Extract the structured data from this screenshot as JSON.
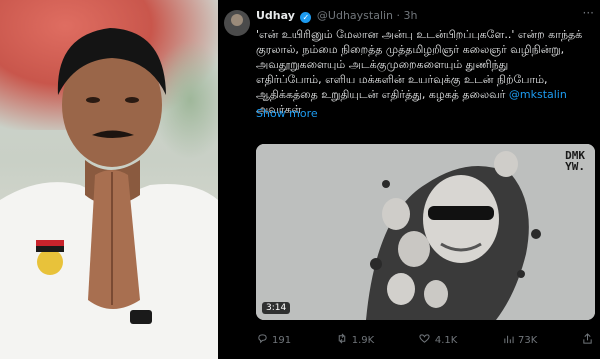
{
  "tweet": {
    "name": "Udhay",
    "verified_mark": "✓",
    "handle": "@Udhaystalin",
    "separator": "·",
    "time": "3h",
    "more_icon": "···",
    "text_line1": "'என் உயிரினும் மேலான அன்பு உடன்பிறப்புகளே..' என்ற காந்தக்",
    "text_line2": "குரலால், நம்மை நிறைத்த முத்தமிழறிஞர் கலைஞர் வழிநின்று,",
    "text_line3": "அவதூறுகளையும் அடக்குமுறைகளையும் துணிந்து",
    "text_line4": "எதிர்ப்போம், எளிய மக்களின் உயர்வுக்கு உடன் நிற்போம்,",
    "text_line5_pre": "ஆதிக்கத்தை உறுதியுடன் எதிர்த்து, கழகத் தலைவர் ",
    "mention": "@mkstalin",
    "text_line6": "அவர்கள்",
    "show_more": "Show more",
    "media": {
      "watermark_line1": "DMK",
      "watermark_line2": "YW.",
      "duration": "3:14"
    },
    "actions": {
      "replies": "191",
      "retweets": "1.9K",
      "likes": "4.1K",
      "views": "73K"
    }
  },
  "icons": {
    "reply": "reply-icon",
    "retweet": "retweet-icon",
    "like": "heart-icon",
    "views": "views-icon",
    "share": "share-icon"
  },
  "colors": {
    "background": "#000000",
    "text": "#e7e9ea",
    "muted": "#71767b",
    "link": "#1d9bf0"
  }
}
